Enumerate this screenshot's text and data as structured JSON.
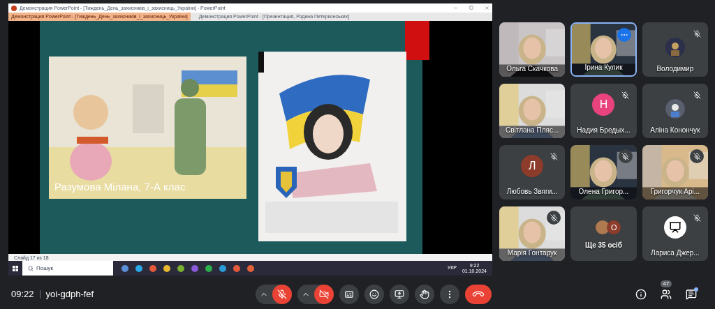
{
  "shared_screen": {
    "window_title": "Демонстрация PowerPoint - [Тиждень_День_захисників_і_захисниць_України] - PowerPoint",
    "tabs": [
      {
        "label": "Демонстрация PowerPoint - [Тиждень_День_захисників_і_захисниць_України]",
        "selected": true
      },
      {
        "label": "Демонстрация PowerPoint - [Презентация, Родина Петерконських]",
        "selected": false
      }
    ],
    "slide": {
      "caption": "Разумова Мілана, 7-А клас"
    },
    "status_bar": {
      "slide_counter": "Слайд 17 из 18"
    },
    "taskbar": {
      "search_placeholder": "Пошук",
      "language": "УКР",
      "time": "9:22",
      "date": "01.10.2024"
    }
  },
  "participants": [
    {
      "name": "Ольга Скачкова",
      "kind": "video",
      "muted": false,
      "selected": false
    },
    {
      "name": "Ірина Кулик",
      "kind": "video",
      "muted": false,
      "selected": true
    },
    {
      "name": "Володимир",
      "muted": true,
      "selected": false
    },
    {
      "name": "Світлана Пляс...",
      "kind": "video",
      "muted": false,
      "selected": false
    },
    {
      "name": "Надия Бредых...",
      "kind": "initial",
      "initial": "Н",
      "color": "#e8437d",
      "muted": true,
      "selected": false
    },
    {
      "name": "Аліна Конончук",
      "muted": true,
      "selected": false
    },
    {
      "name": "Любовь Звяги...",
      "kind": "initial",
      "initial": "Л",
      "color": "#8d3b2b",
      "muted": true,
      "selected": false
    },
    {
      "name": "Олена Григор...",
      "kind": "video",
      "muted": true,
      "selected": false
    },
    {
      "name": "Григорчук Арі...",
      "kind": "video",
      "muted": true,
      "selected": false
    },
    {
      "name": "Марія Гонтарук",
      "kind": "video",
      "muted": true,
      "selected": false
    },
    {
      "name": "Ще 35 осіб",
      "kind": "others",
      "initial": "О",
      "color": "#8d3b2b",
      "muted": false,
      "selected": false
    },
    {
      "name": "Лариса Джер...",
      "kind": "icon",
      "muted": true,
      "selected": false
    }
  ],
  "meeting_bar": {
    "time": "09:22",
    "code": "yoi-gdph-fef",
    "participant_count": "47",
    "mic_on": false,
    "camera_on": false,
    "chat_unread": true
  }
}
